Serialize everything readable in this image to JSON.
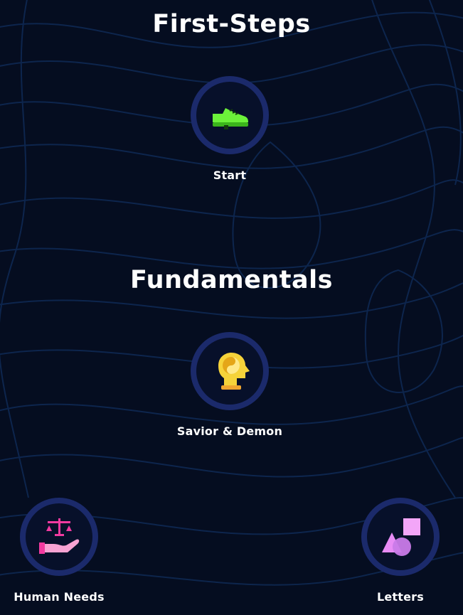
{
  "sections": [
    {
      "title": "First-Steps",
      "lessons": [
        {
          "label": "Start",
          "icon": "shoe-icon"
        }
      ]
    },
    {
      "title": "Fundamentals",
      "lessons": [
        {
          "label": "Savior & Demon",
          "icon": "yin-yang-head-icon"
        },
        {
          "label": "Human Needs",
          "icon": "scales-hand-icon"
        },
        {
          "label": "Letters",
          "icon": "shapes-icon"
        }
      ]
    }
  ],
  "colors": {
    "background": "#050d20",
    "ring": "#1b2a6b",
    "contour_lines": "#0f2a55",
    "shoe": "#6cf23a",
    "head": "#f6d33a",
    "scales": "#f23aa0",
    "shapes": "#e88cf5"
  }
}
